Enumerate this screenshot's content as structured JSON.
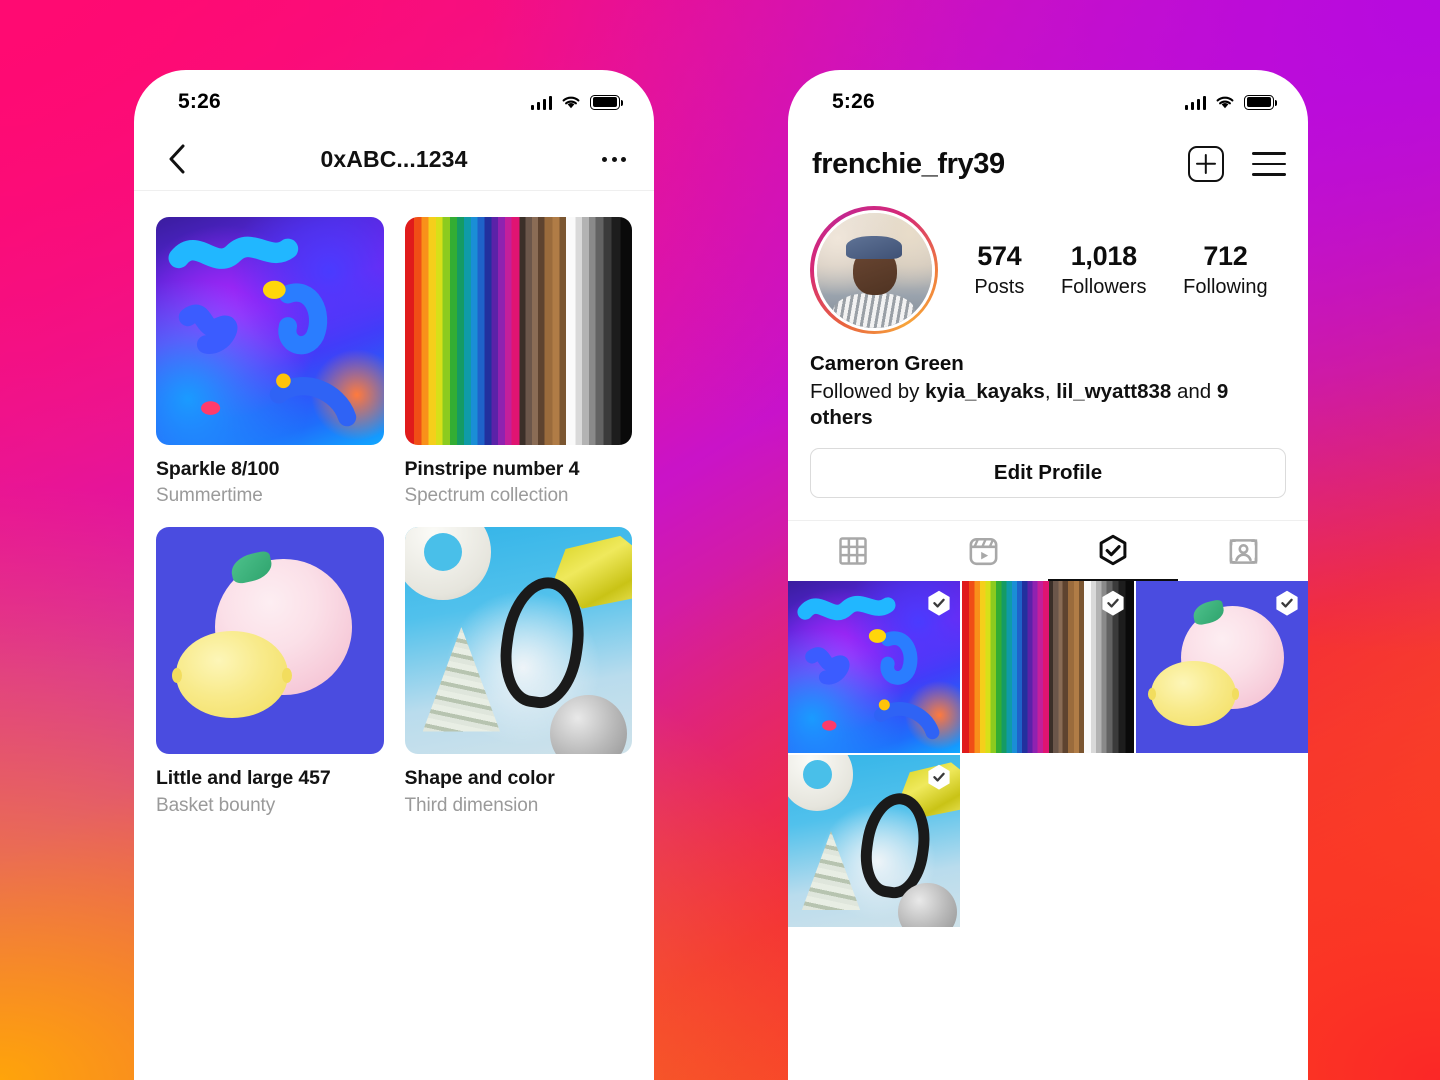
{
  "background": {
    "colors": [
      "#FF0A72",
      "#B70ADF",
      "#FFA40A",
      "#FB2727"
    ]
  },
  "left_phone": {
    "status_bar": {
      "time": "5:26",
      "icons": [
        "cellular-signal-icon",
        "wifi-icon",
        "battery-icon"
      ]
    },
    "nav": {
      "back_icon": "chevron-left-icon",
      "title": "0xABC...1234",
      "more_icon": "more-options-icon"
    },
    "nft_items": [
      {
        "name": "Sparkle 8/100",
        "collection": "Summertime",
        "art": "sparkle"
      },
      {
        "name": "Pinstripe number 4",
        "collection": "Spectrum collection",
        "art": "pinstripe"
      },
      {
        "name": "Little and large 457",
        "collection": "Basket bounty",
        "art": "fruit"
      },
      {
        "name": "Shape and color",
        "collection": "Third dimension",
        "art": "shapes"
      }
    ]
  },
  "right_phone": {
    "status_bar": {
      "time": "5:26",
      "icons": [
        "cellular-signal-icon",
        "wifi-icon",
        "battery-icon"
      ]
    },
    "nav": {
      "username": "frenchie_fry39",
      "add_icon": "plus-square-icon",
      "menu_icon": "hamburger-menu-icon"
    },
    "stats": [
      {
        "value": "574",
        "label": "Posts"
      },
      {
        "value": "1,018",
        "label": "Followers"
      },
      {
        "value": "712",
        "label": "Following"
      }
    ],
    "bio": {
      "display_name": "Cameron Green",
      "followed_by_prefix": "Followed by ",
      "mutual_1": "kyia_kayaks",
      "separator": ", ",
      "mutual_2": "lil_wyatt838",
      "followed_by_suffix": " and ",
      "others": "9 others"
    },
    "edit_profile_label": "Edit Profile",
    "tabs": [
      {
        "icon": "grid-icon",
        "active": false
      },
      {
        "icon": "reels-icon",
        "active": false
      },
      {
        "icon": "nft-hexagon-check-icon",
        "active": true
      },
      {
        "icon": "tagged-person-icon",
        "active": false
      }
    ],
    "posts": [
      {
        "art": "sparkle",
        "badge": "nft-verified-badge-icon"
      },
      {
        "art": "pinstripe",
        "badge": "nft-verified-badge-icon"
      },
      {
        "art": "fruit",
        "badge": "nft-verified-badge-icon"
      },
      {
        "art": "shapes",
        "badge": "nft-verified-badge-icon"
      }
    ]
  }
}
